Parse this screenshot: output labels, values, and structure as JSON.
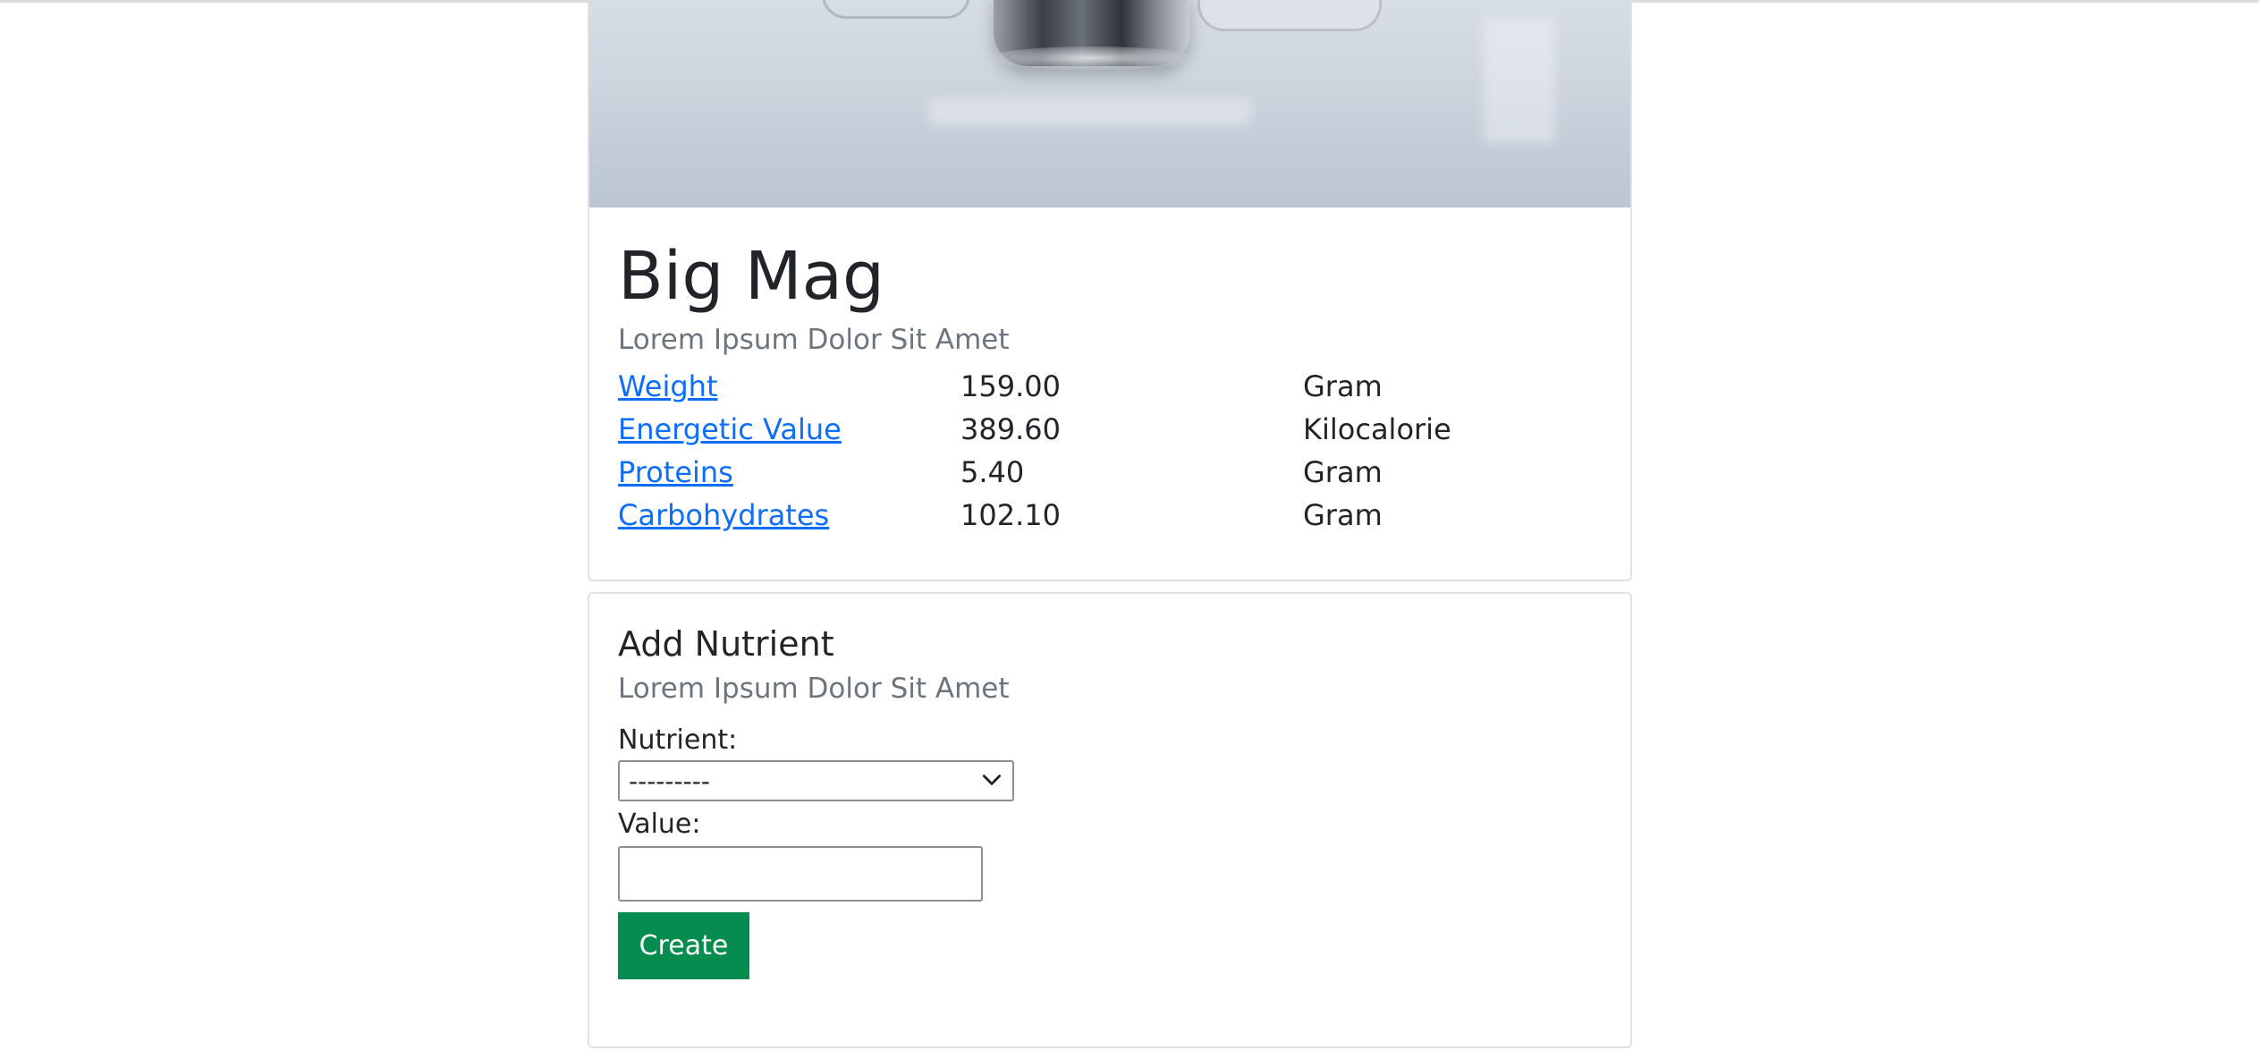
{
  "product": {
    "title": "Big Mag",
    "subtitle": "Lorem Ipsum Dolor Sit Amet",
    "nutrients": [
      {
        "name": "Weight",
        "value": "159.00",
        "unit": "Gram"
      },
      {
        "name": "Energetic Value",
        "value": "389.60",
        "unit": "Kilocalorie"
      },
      {
        "name": "Proteins",
        "value": "5.40",
        "unit": "Gram"
      },
      {
        "name": "Carbohydrates",
        "value": "102.10",
        "unit": "Gram"
      }
    ]
  },
  "add_form": {
    "title": "Add Nutrient",
    "subtitle": "Lorem Ipsum Dolor Sit Amet",
    "nutrient_label": "Nutrient:",
    "nutrient_selected": "---------",
    "value_label": "Value:",
    "value_input": "",
    "create_label": "Create"
  },
  "colors": {
    "link": "#0d6efd",
    "button": "#058c4e",
    "muted": "#6c757d"
  },
  "icons": {
    "select_arrow": "chevron-down-icon"
  }
}
